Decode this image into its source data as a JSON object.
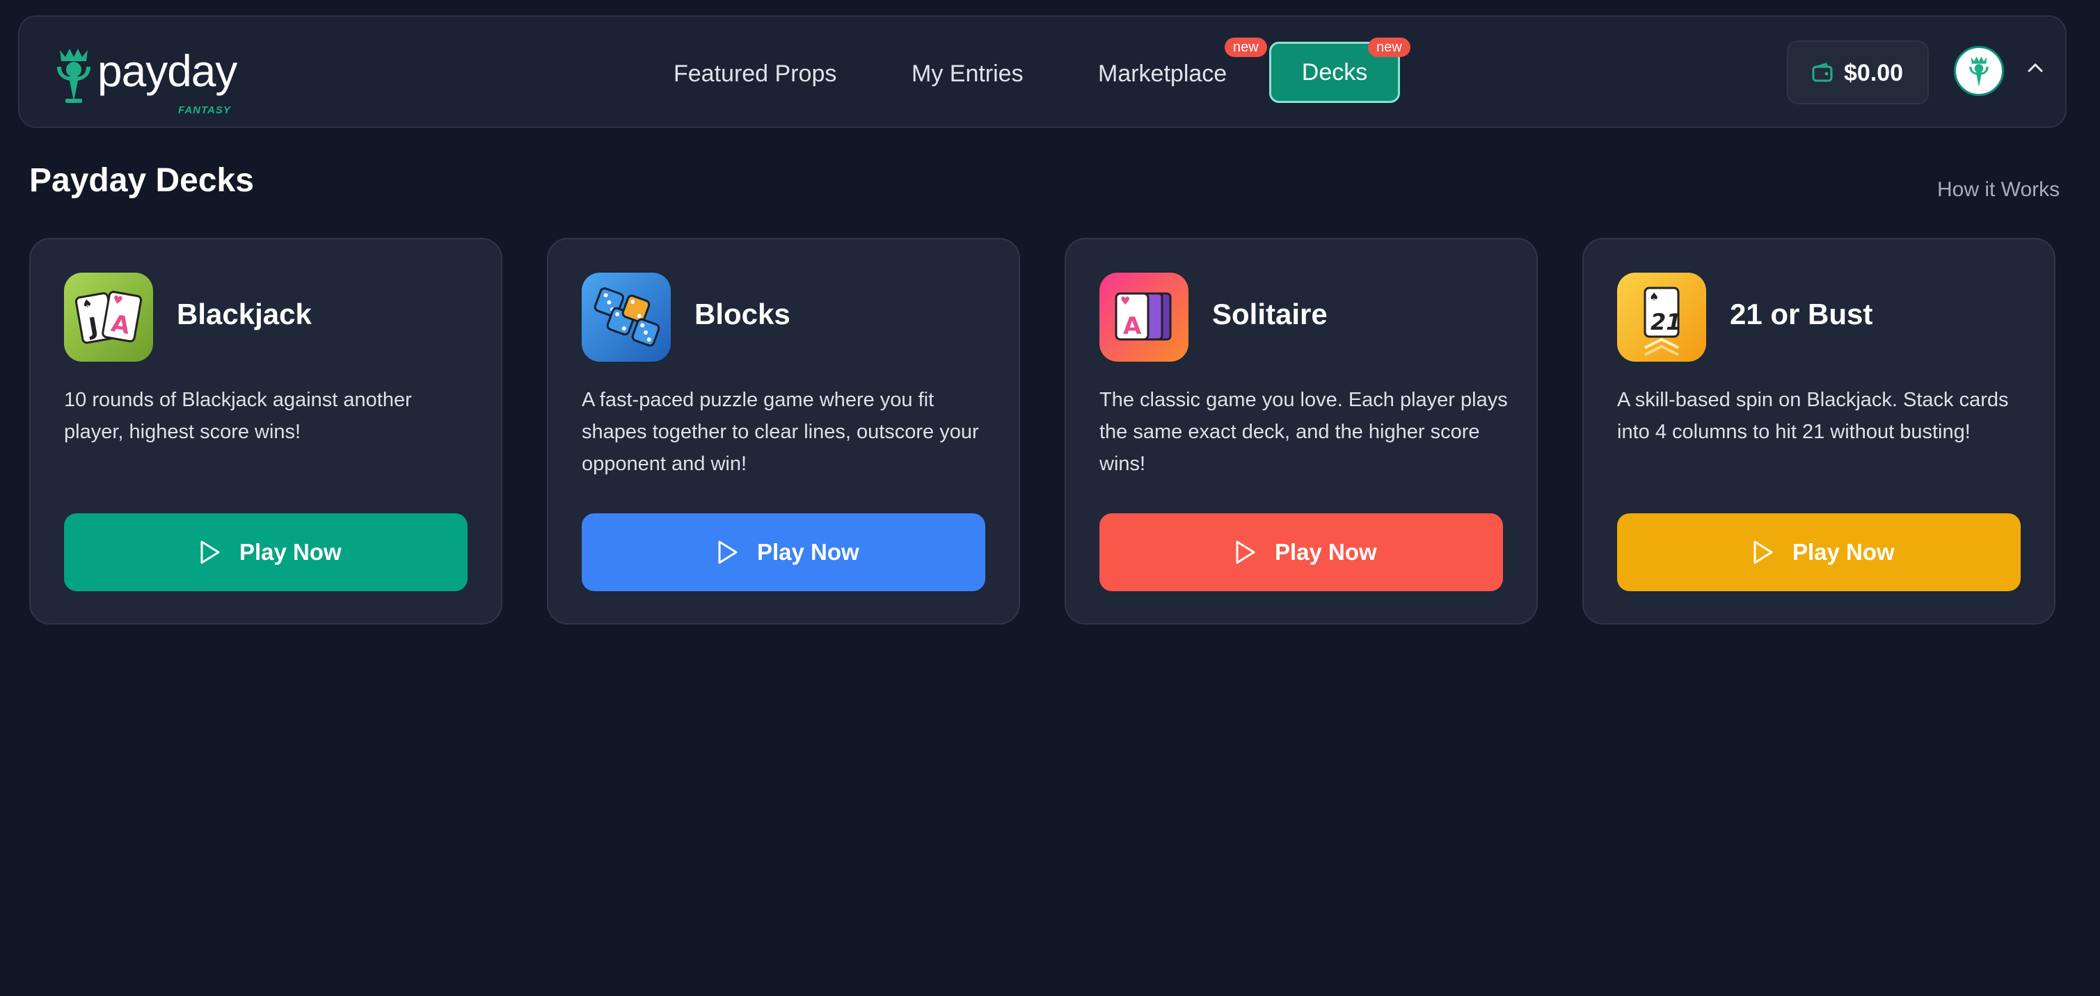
{
  "brand": {
    "name": "payday",
    "sub": "FANTASY"
  },
  "nav": {
    "items": [
      {
        "label": "Featured Props"
      },
      {
        "label": "My Entries"
      },
      {
        "label": "Marketplace",
        "badge": "new"
      },
      {
        "label": "Decks",
        "badge": "new",
        "active": true
      }
    ]
  },
  "wallet": {
    "amount": "$0.00"
  },
  "page": {
    "title": "Payday Decks",
    "how_it_works": "How it Works"
  },
  "games": [
    {
      "title": "Blackjack",
      "description": "10 rounds of Blackjack against another player, highest score wins!",
      "button": "Play Now",
      "color": "#03a383",
      "icon": "blackjack-cards-icon"
    },
    {
      "title": "Blocks",
      "description": "A fast-paced puzzle game where you fit shapes together to clear lines, outscore your opponent and win!",
      "button": "Play Now",
      "color": "#3b82f6",
      "icon": "blocks-dice-icon"
    },
    {
      "title": "Solitaire",
      "description": "The classic game you love. Each player plays the same exact deck, and the higher score wins!",
      "button": "Play Now",
      "color": "#f9574a",
      "icon": "solitaire-cards-icon"
    },
    {
      "title": "21 or Bust",
      "description": "A skill-based spin on Blackjack. Stack cards into 4 columns to hit 21 without busting!",
      "button": "Play Now",
      "color": "#f0ab0a",
      "icon": "twenty-one-card-icon"
    }
  ],
  "colors": {
    "background": "#111726",
    "accent": "#0c8e73",
    "badge": "#ef5147"
  }
}
